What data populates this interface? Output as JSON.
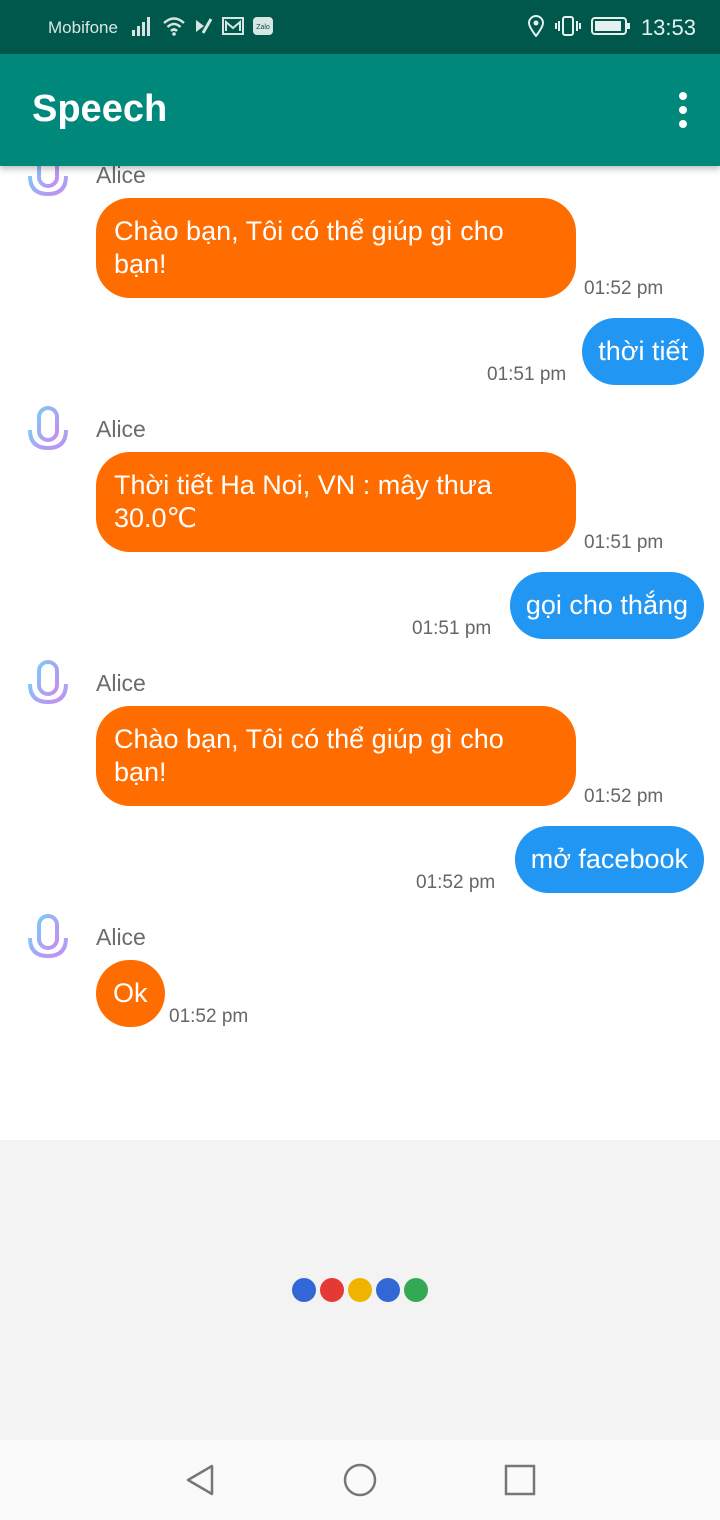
{
  "status_bar": {
    "carrier": "Mobifone",
    "time": "13:53",
    "icons": [
      "signal-icon",
      "wifi-icon",
      "data-icon",
      "mail-icon",
      "zalo-icon",
      "location-icon",
      "vibrate-icon",
      "battery-icon"
    ],
    "zalo_label": "Zalo"
  },
  "app_bar": {
    "title": "Speech",
    "overflow_icon": "more-vert-icon"
  },
  "messages": [
    {
      "sender": "bot",
      "name": "Alice",
      "text": "Chào bạn, Tôi có thể giúp gì cho bạn!",
      "time": "01:52 pm"
    },
    {
      "sender": "user",
      "text": "thời tiết",
      "time": "01:51 pm"
    },
    {
      "sender": "bot",
      "name": "Alice",
      "text": "Thời tiết Ha Noi, VN : mây thưa 30.0℃",
      "time": "01:51 pm"
    },
    {
      "sender": "user",
      "text": "gọi cho thắng",
      "time": "01:51 pm"
    },
    {
      "sender": "bot",
      "name": "Alice",
      "text": "Chào bạn, Tôi có thể giúp gì cho bạn!",
      "time": "01:52 pm"
    },
    {
      "sender": "user",
      "text": "mở facebook",
      "time": "01:52 pm"
    },
    {
      "sender": "bot",
      "name": "Alice",
      "text": "Ok",
      "time": "01:52 pm"
    }
  ],
  "listening_indicator": {
    "colors": [
      "#3367d6",
      "#e53935",
      "#f0b400",
      "#3367d6",
      "#34a853"
    ]
  },
  "nav_bar": {
    "icons": [
      "back-icon",
      "home-icon",
      "recents-icon"
    ]
  },
  "colors": {
    "status_bar": "#00574b",
    "app_bar": "#00897b",
    "bot_bubble": "#ff6d00",
    "user_bubble": "#2196f3"
  }
}
